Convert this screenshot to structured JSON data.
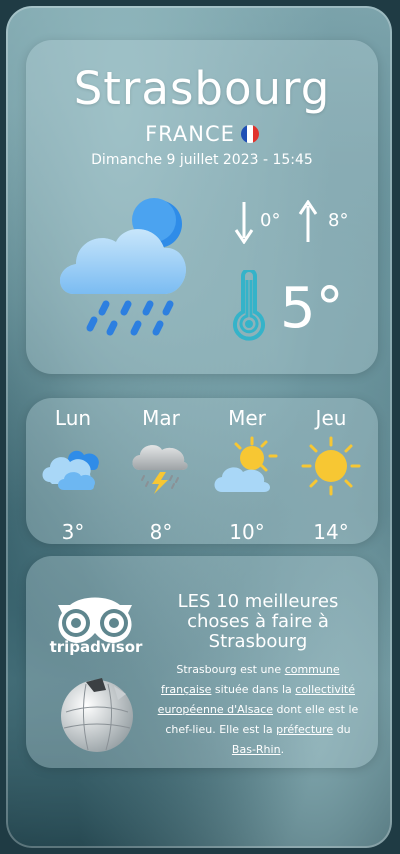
{
  "location": {
    "city": "Strasbourg",
    "country": "FRANCE",
    "datetime": "Dimanche 9 juillet 2023 - 15:45"
  },
  "current": {
    "condition_icon": "cloud-sun-rain-icon",
    "min": "0°",
    "max": "8°",
    "temperature": "5°"
  },
  "forecast": [
    {
      "day": "Lun",
      "icon": "cloudy-icon",
      "temp": "3°"
    },
    {
      "day": "Mar",
      "icon": "thunderstorm-icon",
      "temp": "8°"
    },
    {
      "day": "Mer",
      "icon": "partly-sunny-icon",
      "temp": "10°"
    },
    {
      "day": "Jeu",
      "icon": "sun-icon",
      "temp": "14°"
    }
  ],
  "info": {
    "brand": "tripadvisor",
    "title": "LES 10 meilleures choses à faire à Strasbourg",
    "text": {
      "p1": "Strasbourg est une ",
      "l1": "commune française",
      "p2": " située dans la ",
      "l2": "collectivité européenne d'Alsace",
      "p3": " dont elle est le chef-lieu. Elle est la ",
      "l3": "préfecture",
      "p4": " du ",
      "l4": "Bas-Rhin",
      "p5": "."
    }
  },
  "colors": {
    "card": "#bed7dc",
    "sun": "#f7c733",
    "cloud": "#8fcaf5",
    "rain": "#2d7fe0",
    "thermo": "#35b3c9"
  }
}
